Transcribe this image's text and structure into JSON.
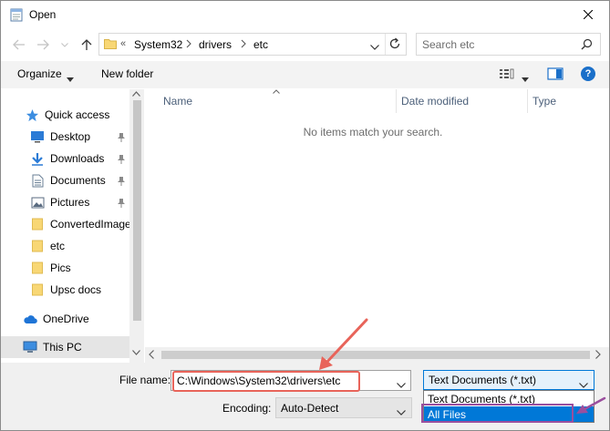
{
  "window": {
    "title": "Open"
  },
  "address": {
    "overflow": "«",
    "crumbs": [
      "System32",
      "drivers",
      "etc"
    ]
  },
  "search": {
    "placeholder": "Search etc"
  },
  "toolbar": {
    "organize": "Organize",
    "new_folder": "New folder",
    "help": "?"
  },
  "nav": {
    "items": [
      {
        "label": "Quick access"
      },
      {
        "label": "Desktop"
      },
      {
        "label": "Downloads"
      },
      {
        "label": "Documents"
      },
      {
        "label": "Pictures"
      },
      {
        "label": "ConvertedImage"
      },
      {
        "label": "etc"
      },
      {
        "label": "Pics"
      },
      {
        "label": "Upsc docs"
      },
      {
        "label": "OneDrive"
      },
      {
        "label": "This PC"
      }
    ]
  },
  "columns": {
    "name": "Name",
    "date": "Date modified",
    "type": "Type"
  },
  "content": {
    "empty_message": "No items match your search."
  },
  "bottom": {
    "file_name_label": "File name:",
    "file_name_value": "C:\\Windows\\System32\\drivers\\etc",
    "type_selected": "Text Documents (*.txt)",
    "type_options": [
      "Text Documents (*.txt)",
      "All Files"
    ],
    "encoding_label": "Encoding:",
    "encoding_value": "Auto-Detect"
  },
  "colors": {
    "accent": "#0078d7",
    "annotation_arrow": "#e8645a",
    "annotation_box": "#9b4f9e"
  }
}
